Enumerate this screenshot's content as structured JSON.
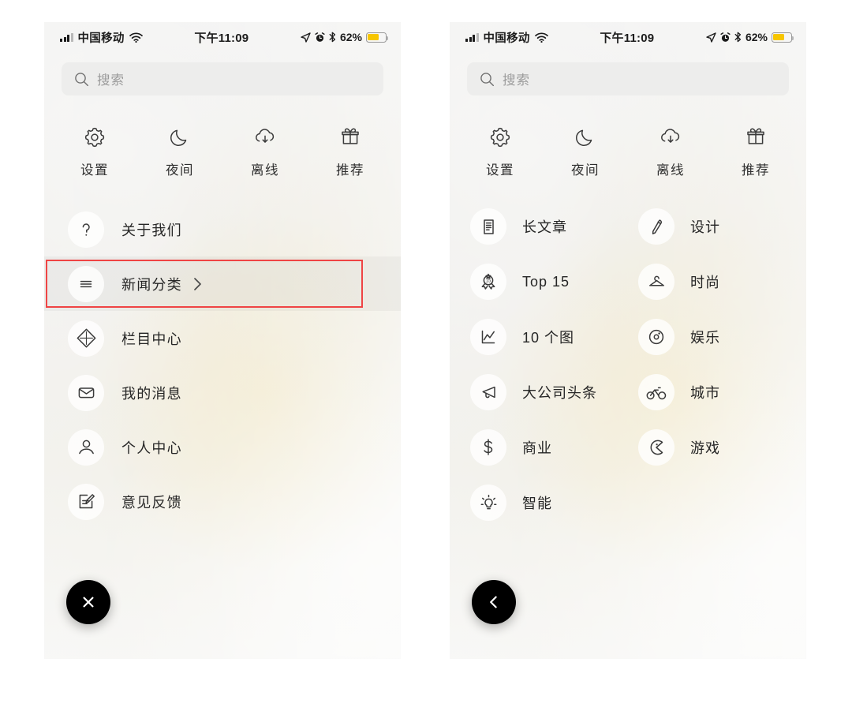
{
  "status_bar": {
    "carrier": "中国移动",
    "time": "下午11:09",
    "battery_percent": "62%",
    "icons": [
      "signal-icon",
      "wifi-icon",
      "location-arrow-icon",
      "alarm-icon",
      "bluetooth-icon",
      "battery-icon"
    ],
    "battery_color": "#f7c600",
    "battery_level": 62
  },
  "search": {
    "placeholder": "搜索",
    "icon": "search-icon"
  },
  "quick_actions": [
    {
      "label": "设置",
      "icon": "gear-icon"
    },
    {
      "label": "夜间",
      "icon": "moon-icon"
    },
    {
      "label": "离线",
      "icon": "cloud-download-icon"
    },
    {
      "label": "推荐",
      "icon": "gift-icon"
    }
  ],
  "left_panel": {
    "menu_items": [
      {
        "label": "关于我们",
        "icon": "question-mark-icon",
        "highlighted": false,
        "chevron": false
      },
      {
        "label": "新闻分类",
        "icon": "hamburger-lines-icon",
        "highlighted": true,
        "chevron": true
      },
      {
        "label": "栏目中心",
        "icon": "diamond-icon",
        "highlighted": false,
        "chevron": false
      },
      {
        "label": "我的消息",
        "icon": "envelope-icon",
        "highlighted": false,
        "chevron": false
      },
      {
        "label": "个人中心",
        "icon": "user-icon",
        "highlighted": false,
        "chevron": false
      },
      {
        "label": "意见反馈",
        "icon": "feedback-edit-icon",
        "highlighted": false,
        "chevron": false
      }
    ],
    "fab": {
      "icon": "close-x-icon",
      "color": "#000000"
    },
    "highlight_color": "#ef4444"
  },
  "right_panel": {
    "categories": [
      {
        "label": "长文章",
        "icon": "document-lines-icon"
      },
      {
        "label": "设计",
        "icon": "pencil-icon"
      },
      {
        "label": "Top 15",
        "icon": "medal-badge-icon",
        "badge_number": "15"
      },
      {
        "label": "时尚",
        "icon": "hanger-icon"
      },
      {
        "label": "10 个图",
        "icon": "line-chart-icon"
      },
      {
        "label": "娱乐",
        "icon": "vinyl-disc-icon"
      },
      {
        "label": "大公司头条",
        "icon": "megaphone-icon"
      },
      {
        "label": "城市",
        "icon": "bicycle-icon"
      },
      {
        "label": "商业",
        "icon": "dollar-sign-icon"
      },
      {
        "label": "游戏",
        "icon": "pacman-icon"
      },
      {
        "label": "智能",
        "icon": "lightbulb-icon"
      }
    ],
    "fab": {
      "icon": "chevron-left-icon",
      "color": "#000000"
    }
  }
}
